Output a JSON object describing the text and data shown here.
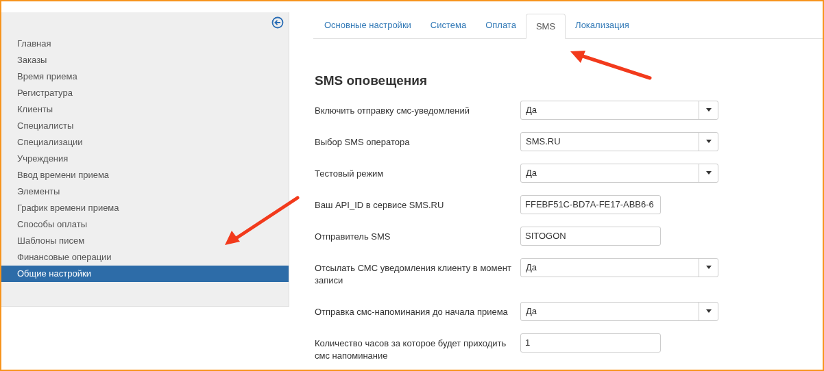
{
  "sidebar": {
    "items": [
      {
        "label": "Главная",
        "selected": false
      },
      {
        "label": "Заказы",
        "selected": false
      },
      {
        "label": "Время приема",
        "selected": false
      },
      {
        "label": "Регистратура",
        "selected": false
      },
      {
        "label": "Клиенты",
        "selected": false
      },
      {
        "label": "Специалисты",
        "selected": false
      },
      {
        "label": "Специализации",
        "selected": false
      },
      {
        "label": "Учреждения",
        "selected": false
      },
      {
        "label": "Ввод времени приема",
        "selected": false
      },
      {
        "label": "Элементы",
        "selected": false
      },
      {
        "label": "График времени приема",
        "selected": false
      },
      {
        "label": "Способы оплаты",
        "selected": false
      },
      {
        "label": "Шаблоны писем",
        "selected": false
      },
      {
        "label": "Финансовые операции",
        "selected": false
      },
      {
        "label": "Общие настройки",
        "selected": true
      }
    ]
  },
  "tabs": [
    {
      "label": "Основные настройки",
      "selected": false
    },
    {
      "label": "Система",
      "selected": false
    },
    {
      "label": "Оплата",
      "selected": false
    },
    {
      "label": "SMS",
      "selected": true
    },
    {
      "label": "Локализация",
      "selected": false
    }
  ],
  "heading": "SMS оповещения",
  "fields": [
    {
      "label": "Включить отправку смс-уведомлений",
      "kind": "select",
      "value": "Да"
    },
    {
      "label": "Выбор SMS оператора",
      "kind": "select",
      "value": "SMS.RU"
    },
    {
      "label": "Тестовый режим",
      "kind": "select",
      "value": "Да"
    },
    {
      "label": "Ваш API_ID в сервисе SMS.RU",
      "kind": "input",
      "value": "FFEBF51C-BD7A-FE17-ABB6-6"
    },
    {
      "label": "Отправитель SMS",
      "kind": "input",
      "value": "SITOGON"
    },
    {
      "label": "Отсылать СМС уведомления клиенту в момент записи",
      "kind": "select",
      "value": "Да"
    },
    {
      "label": "Отправка смс-напоминания до начала приема",
      "kind": "select",
      "value": "Да"
    },
    {
      "label": "Количество часов за которое будет приходить смс напоминание",
      "kind": "input",
      "value": "1"
    }
  ]
}
